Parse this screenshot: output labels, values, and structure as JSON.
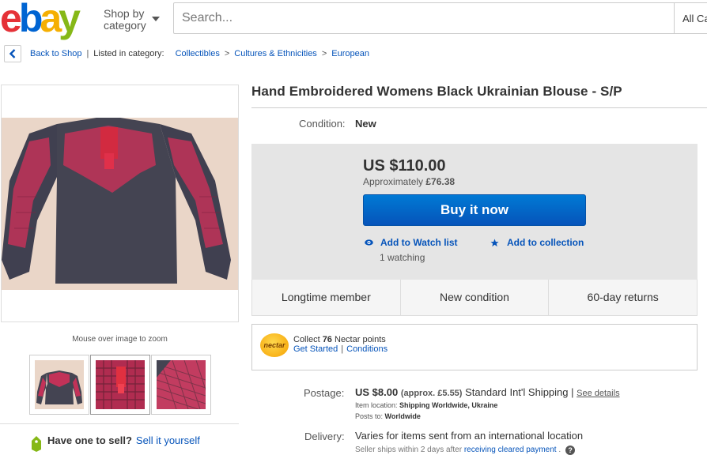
{
  "header": {
    "logo": {
      "e": "e",
      "b": "b",
      "a": "a",
      "y": "y"
    },
    "shop_by_line1": "Shop by",
    "shop_by_line2": "category",
    "search_placeholder": "Search...",
    "category_select": "All Ca"
  },
  "breadcrumb": {
    "back_label": "Back to Shop",
    "listed_in": "Listed in category:",
    "items": [
      "Collectibles",
      "Cultures & Ethnicities",
      "European"
    ],
    "separator": ">"
  },
  "gallery": {
    "zoom_hint": "Mouse over image to zoom",
    "thumbnail_count": 3,
    "selected_thumbnail": 2
  },
  "sell": {
    "prompt": "Have one to sell?",
    "link": "Sell it yourself"
  },
  "item": {
    "title": "Hand Embroidered Womens Black Ukrainian Blouse - S/P",
    "condition_label": "Condition:",
    "condition_value": "New"
  },
  "buy": {
    "price": "US $110.00",
    "approx_prefix": "Approximately ",
    "approx_value": "£76.38",
    "buy_button": "Buy it now",
    "watch_link": "Add to Watch list",
    "watching": "1 watching",
    "collection_link": "Add to collection"
  },
  "features": [
    "Longtime member",
    "New condition",
    "60-day returns"
  ],
  "nectar": {
    "logo_text": "nectar",
    "collect_prefix": "Collect ",
    "points": "76",
    "collect_suffix": " Nectar points",
    "get_started": "Get Started",
    "conditions": "Conditions",
    "separator": "|"
  },
  "postage": {
    "label": "Postage:",
    "cost": "US $8.00",
    "approx": "(approx. £5.55)",
    "service": "Standard Int'l Shipping",
    "separator": "|",
    "details_link": "See details",
    "location_label": "Item location:",
    "location_value": "Shipping Worldwide, Ukraine",
    "posts_to_label": "Posts to:",
    "posts_to_value": "Worldwide"
  },
  "delivery": {
    "label": "Delivery:",
    "value": "Varies for items sent from an international location",
    "sub_prefix": "Seller ships within 2 days after ",
    "sub_link": "receiving cleared payment",
    "sub_suffix": " .",
    "help": "?"
  },
  "colors": {
    "link": "#0654ba",
    "buy_button": "#0654ba",
    "panel_bg": "#e5e5e5",
    "blouse": "#3f3f4a",
    "embroidery": "#c8325a"
  },
  "icons": [
    "chevron-left-icon",
    "dropdown-caret-icon",
    "eye-icon",
    "star-icon",
    "price-tag-icon",
    "help-icon"
  ]
}
